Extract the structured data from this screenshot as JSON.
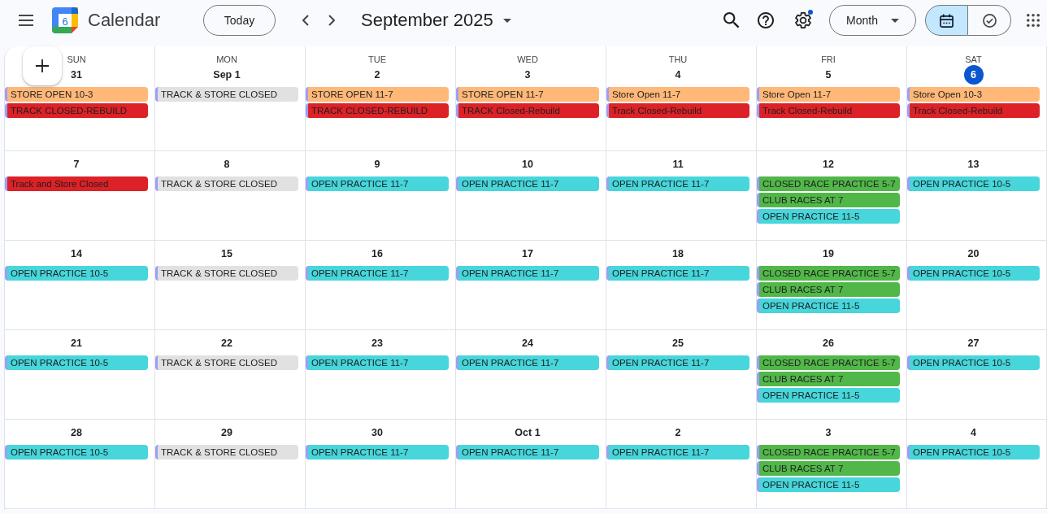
{
  "header": {
    "app_name": "Calendar",
    "logo_date": "6",
    "today_button": "Today",
    "period_title": "September 2025",
    "settings_notification": true,
    "view_selector": "Month",
    "view_toggle": [
      {
        "kind": "calendar",
        "selected": true
      },
      {
        "kind": "tasks",
        "selected": false
      }
    ]
  },
  "weekdays": [
    "SUN",
    "MON",
    "TUE",
    "WED",
    "THU",
    "FRI",
    "SAT"
  ],
  "weeks": [
    {
      "days": [
        {
          "date": "31",
          "today": false,
          "events": [
            {
              "title": "STORE OPEN 10-3",
              "color": "#ffb878"
            },
            {
              "title": "TRACK CLOSED-REBUILD",
              "color": "#dc2127"
            }
          ]
        },
        {
          "date": "Sep 1",
          "today": false,
          "events": [
            {
              "title": "TRACK & STORE CLOSED",
              "color": "#e1e1e1"
            }
          ]
        },
        {
          "date": "2",
          "today": false,
          "events": [
            {
              "title": "STORE OPEN 11-7",
              "color": "#ffb878"
            },
            {
              "title": "TRACK CLOSED-REBUILD",
              "color": "#dc2127"
            }
          ]
        },
        {
          "date": "3",
          "today": false,
          "events": [
            {
              "title": "STORE OPEN 11-7",
              "color": "#ffb878"
            },
            {
              "title": "TRACK Closed-Rebuild",
              "color": "#dc2127"
            }
          ]
        },
        {
          "date": "4",
          "today": false,
          "events": [
            {
              "title": "Store Open 11-7",
              "color": "#ffb878"
            },
            {
              "title": "Track Closed-Rebuild",
              "color": "#dc2127"
            }
          ]
        },
        {
          "date": "5",
          "today": false,
          "events": [
            {
              "title": "Store Open 11-7",
              "color": "#ffb878"
            },
            {
              "title": "Track Closed-Rebuild",
              "color": "#dc2127"
            }
          ]
        },
        {
          "date": "6",
          "today": true,
          "events": [
            {
              "title": "Store Open 10-3",
              "color": "#ffb878"
            },
            {
              "title": "Track Closed-Rebuild",
              "color": "#dc2127"
            }
          ]
        }
      ]
    },
    {
      "days": [
        {
          "date": "7",
          "today": false,
          "events": [
            {
              "title": "Track and Store Closed",
              "color": "#dc2127"
            }
          ]
        },
        {
          "date": "8",
          "today": false,
          "events": [
            {
              "title": "TRACK & STORE CLOSED",
              "color": "#e1e1e1"
            }
          ]
        },
        {
          "date": "9",
          "today": false,
          "events": [
            {
              "title": "OPEN PRACTICE 11-7",
              "color": "#46d6db"
            }
          ]
        },
        {
          "date": "10",
          "today": false,
          "events": [
            {
              "title": "OPEN PRACTICE 11-7",
              "color": "#46d6db"
            }
          ]
        },
        {
          "date": "11",
          "today": false,
          "events": [
            {
              "title": "OPEN PRACTICE 11-7",
              "color": "#46d6db"
            }
          ]
        },
        {
          "date": "12",
          "today": false,
          "events": [
            {
              "title": "CLOSED RACE PRACTICE 5-7",
              "color": "#51b749"
            },
            {
              "title": "CLUB RACES AT 7",
              "color": "#51b749"
            },
            {
              "title": "OPEN PRACTICE 11-5",
              "color": "#46d6db"
            }
          ]
        },
        {
          "date": "13",
          "today": false,
          "events": [
            {
              "title": "OPEN PRACTICE 10-5",
              "color": "#46d6db"
            }
          ]
        }
      ]
    },
    {
      "days": [
        {
          "date": "14",
          "today": false,
          "events": [
            {
              "title": "OPEN PRACTICE 10-5",
              "color": "#46d6db"
            }
          ]
        },
        {
          "date": "15",
          "today": false,
          "events": [
            {
              "title": "TRACK & STORE CLOSED",
              "color": "#e1e1e1"
            }
          ]
        },
        {
          "date": "16",
          "today": false,
          "events": [
            {
              "title": "OPEN PRACTICE 11-7",
              "color": "#46d6db"
            }
          ]
        },
        {
          "date": "17",
          "today": false,
          "events": [
            {
              "title": "OPEN PRACTICE 11-7",
              "color": "#46d6db"
            }
          ]
        },
        {
          "date": "18",
          "today": false,
          "events": [
            {
              "title": "OPEN PRACTICE 11-7",
              "color": "#46d6db"
            }
          ]
        },
        {
          "date": "19",
          "today": false,
          "events": [
            {
              "title": "CLOSED RACE PRACTICE 5-7",
              "color": "#51b749"
            },
            {
              "title": "CLUB RACES AT 7",
              "color": "#51b749"
            },
            {
              "title": "OPEN PRACTICE 11-5",
              "color": "#46d6db"
            }
          ]
        },
        {
          "date": "20",
          "today": false,
          "events": [
            {
              "title": "OPEN PRACTICE 10-5",
              "color": "#46d6db"
            }
          ]
        }
      ]
    },
    {
      "days": [
        {
          "date": "21",
          "today": false,
          "events": [
            {
              "title": "OPEN PRACTICE 10-5",
              "color": "#46d6db"
            }
          ]
        },
        {
          "date": "22",
          "today": false,
          "events": [
            {
              "title": "TRACK & STORE CLOSED",
              "color": "#e1e1e1"
            }
          ]
        },
        {
          "date": "23",
          "today": false,
          "events": [
            {
              "title": "OPEN PRACTICE 11-7",
              "color": "#46d6db"
            }
          ]
        },
        {
          "date": "24",
          "today": false,
          "events": [
            {
              "title": "OPEN PRACTICE 11-7",
              "color": "#46d6db"
            }
          ]
        },
        {
          "date": "25",
          "today": false,
          "events": [
            {
              "title": "OPEN PRACTICE 11-7",
              "color": "#46d6db"
            }
          ]
        },
        {
          "date": "26",
          "today": false,
          "events": [
            {
              "title": "CLOSED RACE PRACTICE 5-7",
              "color": "#51b749"
            },
            {
              "title": "CLUB RACES AT 7",
              "color": "#51b749"
            },
            {
              "title": "OPEN PRACTICE 11-5",
              "color": "#46d6db"
            }
          ]
        },
        {
          "date": "27",
          "today": false,
          "events": [
            {
              "title": "OPEN PRACTICE 10-5",
              "color": "#46d6db"
            }
          ]
        }
      ]
    },
    {
      "days": [
        {
          "date": "28",
          "today": false,
          "events": [
            {
              "title": "OPEN PRACTICE 10-5",
              "color": "#46d6db"
            }
          ]
        },
        {
          "date": "29",
          "today": false,
          "events": [
            {
              "title": "TRACK & STORE CLOSED",
              "color": "#e1e1e1"
            }
          ]
        },
        {
          "date": "30",
          "today": false,
          "events": [
            {
              "title": "OPEN PRACTICE 11-7",
              "color": "#46d6db"
            }
          ]
        },
        {
          "date": "Oct 1",
          "today": false,
          "events": [
            {
              "title": "OPEN PRACTICE 11-7",
              "color": "#46d6db"
            }
          ]
        },
        {
          "date": "2",
          "today": false,
          "events": [
            {
              "title": "OPEN PRACTICE 11-7",
              "color": "#46d6db"
            }
          ]
        },
        {
          "date": "3",
          "today": false,
          "events": [
            {
              "title": "CLOSED RACE PRACTICE 5-7",
              "color": "#51b749"
            },
            {
              "title": "CLUB RACES AT 7",
              "color": "#51b749"
            },
            {
              "title": "OPEN PRACTICE 11-5",
              "color": "#46d6db"
            }
          ]
        },
        {
          "date": "4",
          "today": false,
          "events": [
            {
              "title": "OPEN PRACTICE 10-5",
              "color": "#46d6db"
            }
          ]
        }
      ]
    }
  ]
}
